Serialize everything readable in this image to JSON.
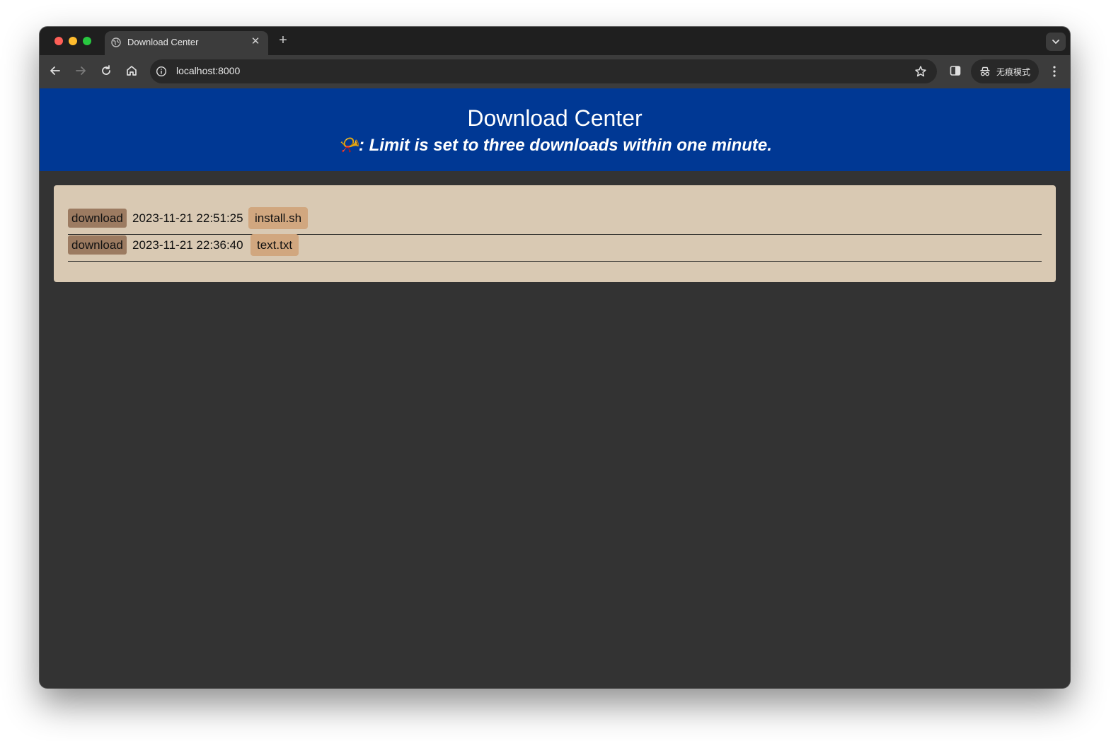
{
  "browser": {
    "tab": {
      "title": "Download Center",
      "close_glyph": "✕"
    },
    "new_tab_glyph": "+",
    "address": {
      "url": "localhost:8000"
    },
    "incognito_label": "无痕模式"
  },
  "page": {
    "title": "Download Center",
    "notice": "📯: Limit is set to three downloads within one minute."
  },
  "downloads": [
    {
      "button": "download",
      "timestamp": "2023-11-21 22:51:25",
      "filename": "install.sh"
    },
    {
      "button": "download",
      "timestamp": "2023-11-21 22:36:40",
      "filename": "text.txt"
    }
  ],
  "colors": {
    "banner": "#003894",
    "panel": "#d9c9b3",
    "download_button": "#9c7b61",
    "filename_chip": "#d1a77f",
    "page_background": "#333333"
  },
  "icons": [
    "globe-icon",
    "close-icon",
    "plus-icon",
    "chevron-down-icon",
    "back-arrow-icon",
    "forward-arrow-icon",
    "reload-icon",
    "home-icon",
    "info-icon",
    "star-icon",
    "side-panel-icon",
    "incognito-icon",
    "kebab-menu-icon"
  ]
}
